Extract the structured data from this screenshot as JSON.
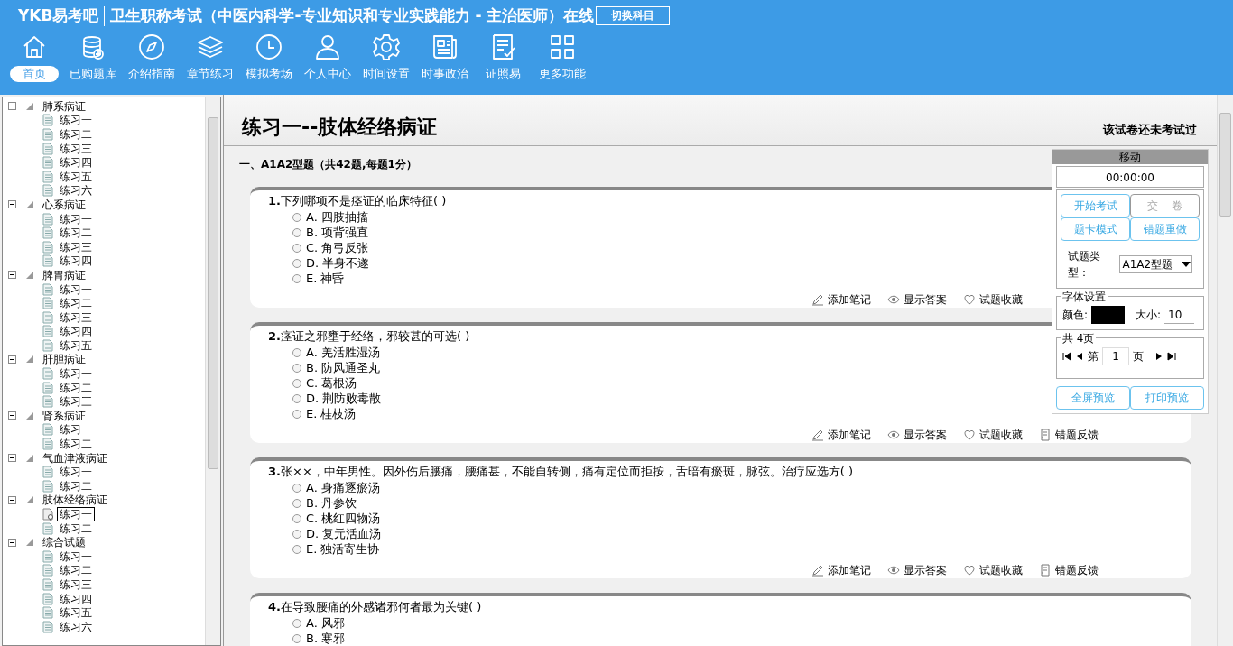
{
  "header": {
    "logo": "YKB易考吧",
    "title": "卫生职称考试（中医内科学-专业知识和专业实践能力 - 主治医师）在线",
    "switch_button": "切换科目"
  },
  "toolbar": [
    {
      "kind": "home",
      "label": "首页",
      "selected": true
    },
    {
      "kind": "database",
      "label": "已购题库",
      "selected": false
    },
    {
      "kind": "compass",
      "label": "介绍指南",
      "selected": false
    },
    {
      "kind": "layers",
      "label": "章节练习",
      "selected": false
    },
    {
      "kind": "clock",
      "label": "模拟考场",
      "selected": false
    },
    {
      "kind": "person",
      "label": "个人中心",
      "selected": false
    },
    {
      "kind": "gear",
      "label": "时间设置",
      "selected": false
    },
    {
      "kind": "news",
      "label": "时事政治",
      "selected": false
    },
    {
      "kind": "checklist",
      "label": "证照易",
      "selected": false
    },
    {
      "kind": "grid",
      "label": "更多功能",
      "selected": false
    }
  ],
  "tree": [
    {
      "label": "肺系病证",
      "expanded": true,
      "children": [
        {
          "label": "练习一",
          "selected": false
        },
        {
          "label": "练习二",
          "selected": false
        },
        {
          "label": "练习三",
          "selected": false
        },
        {
          "label": "练习四",
          "selected": false
        },
        {
          "label": "练习五",
          "selected": false
        },
        {
          "label": "练习六",
          "selected": false
        }
      ]
    },
    {
      "label": "心系病证",
      "expanded": true,
      "children": [
        {
          "label": "练习一",
          "selected": false
        },
        {
          "label": "练习二",
          "selected": false
        },
        {
          "label": "练习三",
          "selected": false
        },
        {
          "label": "练习四",
          "selected": false
        }
      ]
    },
    {
      "label": "脾胃病证",
      "expanded": true,
      "children": [
        {
          "label": "练习一",
          "selected": false
        },
        {
          "label": "练习二",
          "selected": false
        },
        {
          "label": "练习三",
          "selected": false
        },
        {
          "label": "练习四",
          "selected": false
        },
        {
          "label": "练习五",
          "selected": false
        }
      ]
    },
    {
      "label": "肝胆病证",
      "expanded": true,
      "children": [
        {
          "label": "练习一",
          "selected": false
        },
        {
          "label": "练习二",
          "selected": false
        },
        {
          "label": "练习三",
          "selected": false
        }
      ]
    },
    {
      "label": "肾系病证",
      "expanded": true,
      "children": [
        {
          "label": "练习一",
          "selected": false
        },
        {
          "label": "练习二",
          "selected": false
        }
      ]
    },
    {
      "label": "气血津液病证",
      "expanded": true,
      "children": [
        {
          "label": "练习一",
          "selected": false
        },
        {
          "label": "练习二",
          "selected": false
        }
      ]
    },
    {
      "label": "肢体经络病证",
      "expanded": true,
      "children": [
        {
          "label": "练习一",
          "selected": true
        },
        {
          "label": "练习二",
          "selected": false
        }
      ]
    },
    {
      "label": "综合试题",
      "expanded": true,
      "children": [
        {
          "label": "练习一",
          "selected": false
        },
        {
          "label": "练习二",
          "selected": false
        },
        {
          "label": "练习三",
          "selected": false
        },
        {
          "label": "练习四",
          "selected": false
        },
        {
          "label": "练习五",
          "selected": false
        },
        {
          "label": "练习六",
          "selected": false
        }
      ]
    }
  ],
  "exam": {
    "title": "练习一--肢体经络病证",
    "status": "该试卷还未考试过",
    "section": "一、A1A2型题（共42题,每题1分）",
    "questions": [
      {
        "number": "1.",
        "text": "下列哪项不是痉证的临床特征( )",
        "options": [
          {
            "letter": "A.",
            "text": "四肢抽搐",
            "selected": false
          },
          {
            "letter": "B.",
            "text": "项背强直",
            "selected": false
          },
          {
            "letter": "C.",
            "text": "角弓反张",
            "selected": false
          },
          {
            "letter": "D.",
            "text": "半身不遂",
            "selected": false
          },
          {
            "letter": "E.",
            "text": "神昏",
            "selected": false
          }
        ],
        "actions": [
          {
            "kind": "note",
            "label": "添加笔记"
          },
          {
            "kind": "answer",
            "label": "显示答案"
          },
          {
            "kind": "favorite",
            "label": "试题收藏"
          }
        ]
      },
      {
        "number": "2.",
        "text": "痉证之邪壅于经络，邪较甚的可选( )",
        "options": [
          {
            "letter": "A.",
            "text": "羌活胜湿汤",
            "selected": false
          },
          {
            "letter": "B.",
            "text": "防风通圣丸",
            "selected": false
          },
          {
            "letter": "C.",
            "text": "葛根汤",
            "selected": false
          },
          {
            "letter": "D.",
            "text": "荆防败毒散",
            "selected": false
          },
          {
            "letter": "E.",
            "text": "桂枝汤",
            "selected": false
          }
        ],
        "actions": [
          {
            "kind": "note",
            "label": "添加笔记"
          },
          {
            "kind": "answer",
            "label": "显示答案"
          },
          {
            "kind": "favorite",
            "label": "试题收藏"
          },
          {
            "kind": "feedback",
            "label": "错题反馈"
          }
        ]
      },
      {
        "number": "3.",
        "text": "张××，中年男性。因外伤后腰痛，腰痛甚，不能自转侧，痛有定位而拒按，舌暗有瘀斑，脉弦。治疗应选方( )",
        "options": [
          {
            "letter": "A.",
            "text": "身痛逐瘀汤",
            "selected": false
          },
          {
            "letter": "B.",
            "text": "丹参饮",
            "selected": false
          },
          {
            "letter": "C.",
            "text": "桃红四物汤",
            "selected": false
          },
          {
            "letter": "D.",
            "text": "复元活血汤",
            "selected": false
          },
          {
            "letter": "E.",
            "text": "独活寄生协",
            "selected": false
          }
        ],
        "actions": [
          {
            "kind": "note",
            "label": "添加笔记"
          },
          {
            "kind": "answer",
            "label": "显示答案"
          },
          {
            "kind": "favorite",
            "label": "试题收藏"
          },
          {
            "kind": "feedback",
            "label": "错题反馈"
          }
        ]
      },
      {
        "number": "4.",
        "text": "在导致腰痛的外感诸邪何者最为关键( )",
        "options": [
          {
            "letter": "A.",
            "text": "风邪",
            "selected": false
          },
          {
            "letter": "B.",
            "text": "寒邪",
            "selected": false
          }
        ]
      }
    ]
  },
  "panel": {
    "title": "移动",
    "timer": "00:00:00",
    "buttons": [
      {
        "label": "开始考试",
        "disabled": false
      },
      {
        "label": "交    卷",
        "disabled": true
      },
      {
        "label": "题卡模式",
        "disabled": false
      },
      {
        "label": "错题重做",
        "disabled": false
      }
    ],
    "type_label": "试题类型：",
    "type_value": "A1A2型题",
    "font": {
      "legend": "字体设置",
      "color_label": "颜色:",
      "color": "#000000",
      "size_label": "大小:",
      "size": "10"
    },
    "pager": {
      "legend": "共 4页",
      "prefix": "第",
      "page": "1",
      "suffix": "页"
    },
    "bottom_buttons": [
      {
        "label": "全屏预览",
        "disabled": false
      },
      {
        "label": "打印预览",
        "disabled": false
      }
    ]
  }
}
